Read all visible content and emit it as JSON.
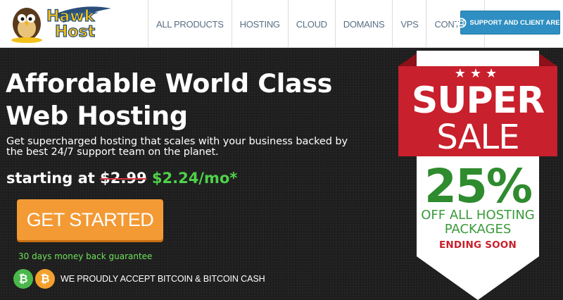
{
  "brand": {
    "logo_text": "Hawk Host",
    "logo_line1": "Hawk",
    "logo_line2": "Host"
  },
  "nav": {
    "items": [
      "ALL PRODUCTS",
      "HOSTING",
      "CLOUD",
      "DOMAINS",
      "VPS",
      "CONTACT"
    ],
    "support_button": "SUPPORT AND CLIENT AREA",
    "support_icon": "lifebuoy-icon"
  },
  "hero": {
    "headline_line1": "Affordable World Class",
    "headline_line2": "Web Hosting",
    "subline_line1": "Get supercharged hosting that scales with your business backed by",
    "subline_line2": "the best 24/7 support team on the planet.",
    "price_prefix": "starting at",
    "old_price": "$2.99",
    "new_price": "$2.24/mo*",
    "cta_label": "GET STARTED",
    "guarantee": "30 days money back guarantee",
    "crypto_text": "WE PROUDLY ACCEPT BITCOIN & BITCOIN CASH",
    "bitcoin_symbol": "₿",
    "bitcoin_icon": "bitcoin-icon",
    "bitcoin_cash_icon": "bitcoin-cash-icon"
  },
  "sale_badge": {
    "stars": "★★★",
    "line1": "SUPER",
    "line2": "SALE",
    "percent": "25%",
    "off_line1": "OFF ALL HOSTING",
    "off_line2": "PACKAGES",
    "ending": "ENDING SOON"
  },
  "colors": {
    "header_bg": "#ffffff",
    "hero_bg": "#1e1e1e",
    "nav_text": "#5a6f86",
    "support_btn": "#2f8fc2",
    "cta_orange": "#f39a34",
    "price_green": "#4fd14a",
    "badge_red": "#c8202c",
    "badge_green": "#2e8b2e"
  }
}
